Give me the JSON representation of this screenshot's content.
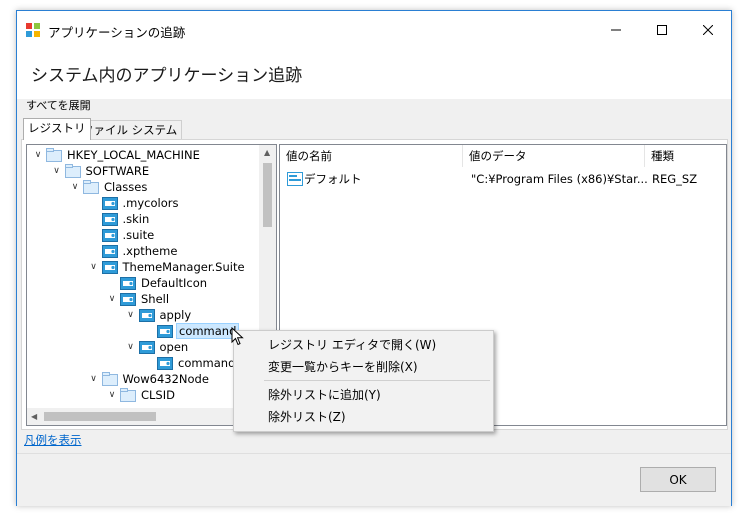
{
  "window": {
    "title": "アプリケーションの追跡"
  },
  "header": {
    "heading": "システム内のアプリケーション追跡"
  },
  "toolbar": {
    "expand_all": "すべてを展開"
  },
  "tabs": [
    {
      "label": "レジストリ",
      "active": true
    },
    {
      "label": "ファイル システム",
      "active": false
    }
  ],
  "tree": {
    "nodes": [
      {
        "label": "HKEY_LOCAL_MACHINE",
        "expanded": true
      },
      {
        "label": "SOFTWARE",
        "expanded": true
      },
      {
        "label": "Classes",
        "expanded": true
      },
      {
        "label": ".mycolors"
      },
      {
        "label": ".skin"
      },
      {
        "label": ".suite"
      },
      {
        "label": ".xptheme"
      },
      {
        "label": "ThemeManager.Suite",
        "expanded": true
      },
      {
        "label": "DefaultIcon"
      },
      {
        "label": "Shell",
        "expanded": true
      },
      {
        "label": "apply",
        "expanded": true
      },
      {
        "label": "command",
        "selected": true
      },
      {
        "label": "open",
        "expanded": true
      },
      {
        "label": "command"
      },
      {
        "label": "Wow6432Node",
        "expanded": true
      },
      {
        "label": "CLSID",
        "expanded": true
      }
    ]
  },
  "values_list": {
    "columns": [
      "値の名前",
      "値のデータ",
      "種類"
    ],
    "rows": [
      {
        "name": "デフォルト",
        "data": "\"C:¥Program Files (x86)¥Star...",
        "type": "REG_SZ"
      }
    ]
  },
  "links": {
    "legend": "凡例を表示"
  },
  "buttons": {
    "ok": "OK"
  },
  "context_menu": {
    "items": [
      {
        "label": "レジストリ エディタで開く(W)"
      },
      {
        "label": "変更一覧からキーを削除(X)"
      },
      {
        "label": "除外リストに追加(Y)"
      },
      {
        "label": "除外リスト(Z)"
      }
    ]
  },
  "colors": {
    "accent": "#2a7fd3",
    "selection": "#cce8ff",
    "key_icon": "#2f9bd8"
  }
}
